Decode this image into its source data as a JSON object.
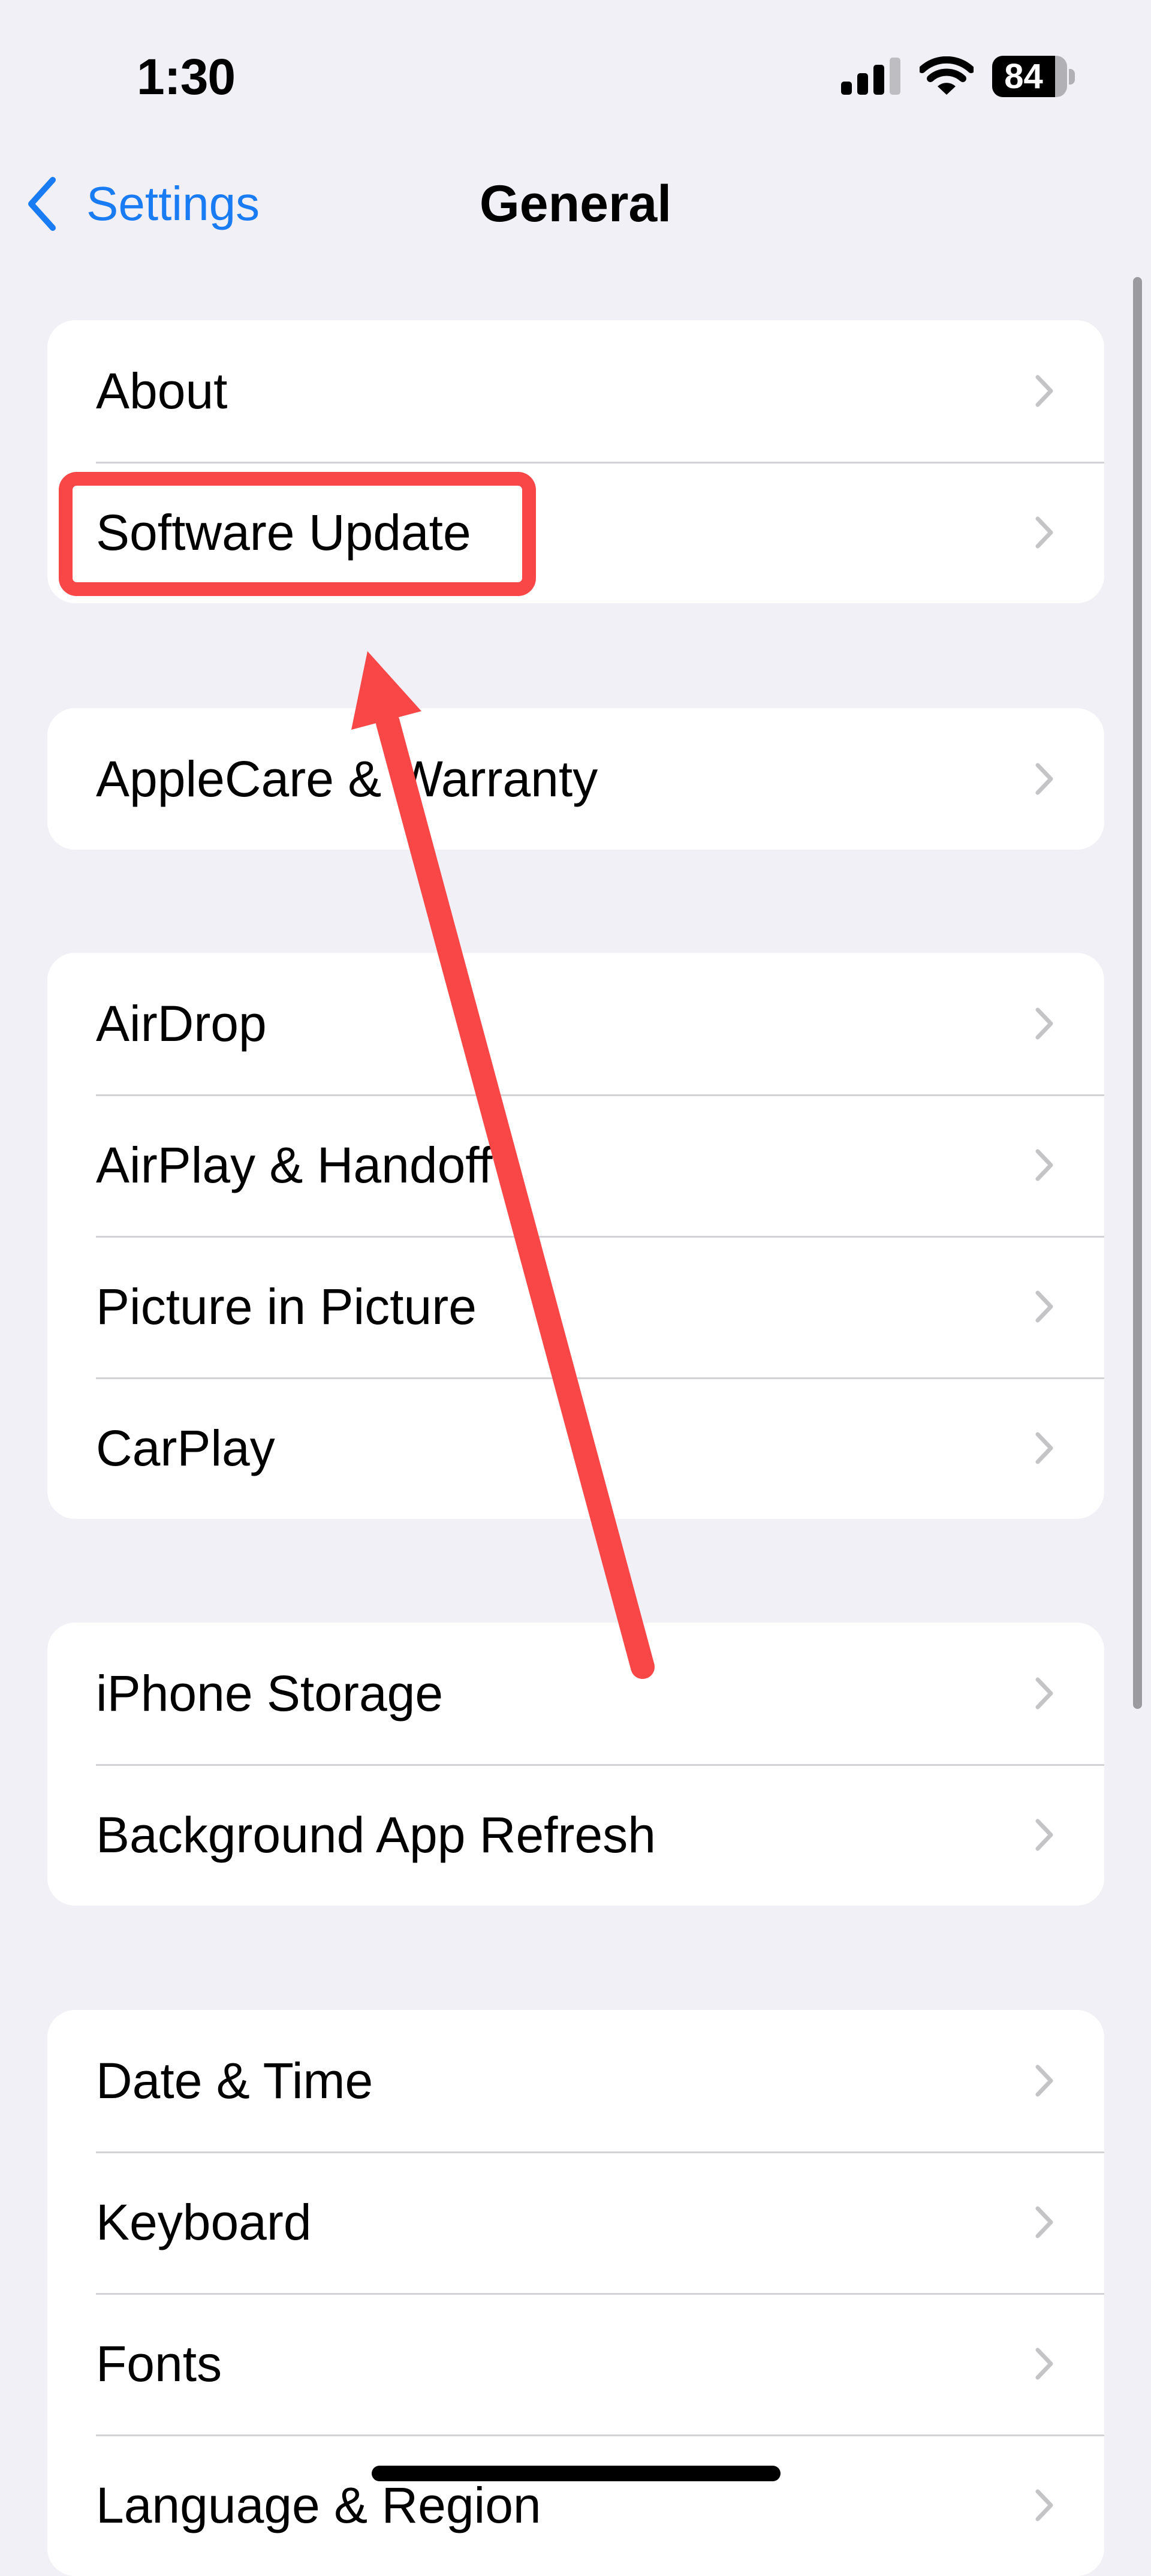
{
  "status_bar": {
    "time": "1:30",
    "signal_bars": 3,
    "signal_bars_total": 4,
    "wifi_icon": "wifi-icon",
    "battery_percent": "84",
    "battery_level": 0.84
  },
  "nav": {
    "back_label": "Settings",
    "back_icon": "chevron-left-icon",
    "title": "General"
  },
  "groups": [
    {
      "rows": [
        {
          "label": "About"
        },
        {
          "label": "Software Update"
        }
      ]
    },
    {
      "rows": [
        {
          "label": "AppleCare & Warranty"
        }
      ]
    },
    {
      "rows": [
        {
          "label": "AirDrop"
        },
        {
          "label": "AirPlay & Handoff"
        },
        {
          "label": "Picture in Picture"
        },
        {
          "label": "CarPlay"
        }
      ]
    },
    {
      "rows": [
        {
          "label": "iPhone Storage"
        },
        {
          "label": "Background App Refresh"
        }
      ]
    },
    {
      "rows": [
        {
          "label": "Date & Time"
        },
        {
          "label": "Keyboard"
        },
        {
          "label": "Fonts"
        },
        {
          "label": "Language & Region"
        }
      ]
    }
  ],
  "row_icon": "chevron-right-icon",
  "annotation": {
    "highlighted_item": "Software Update",
    "color": "#f94646"
  },
  "colors": {
    "accent": "#1a7cf5",
    "background": "#f0f0f6",
    "chevron": "#c4c4c7",
    "separator": "#d1d1d6"
  }
}
